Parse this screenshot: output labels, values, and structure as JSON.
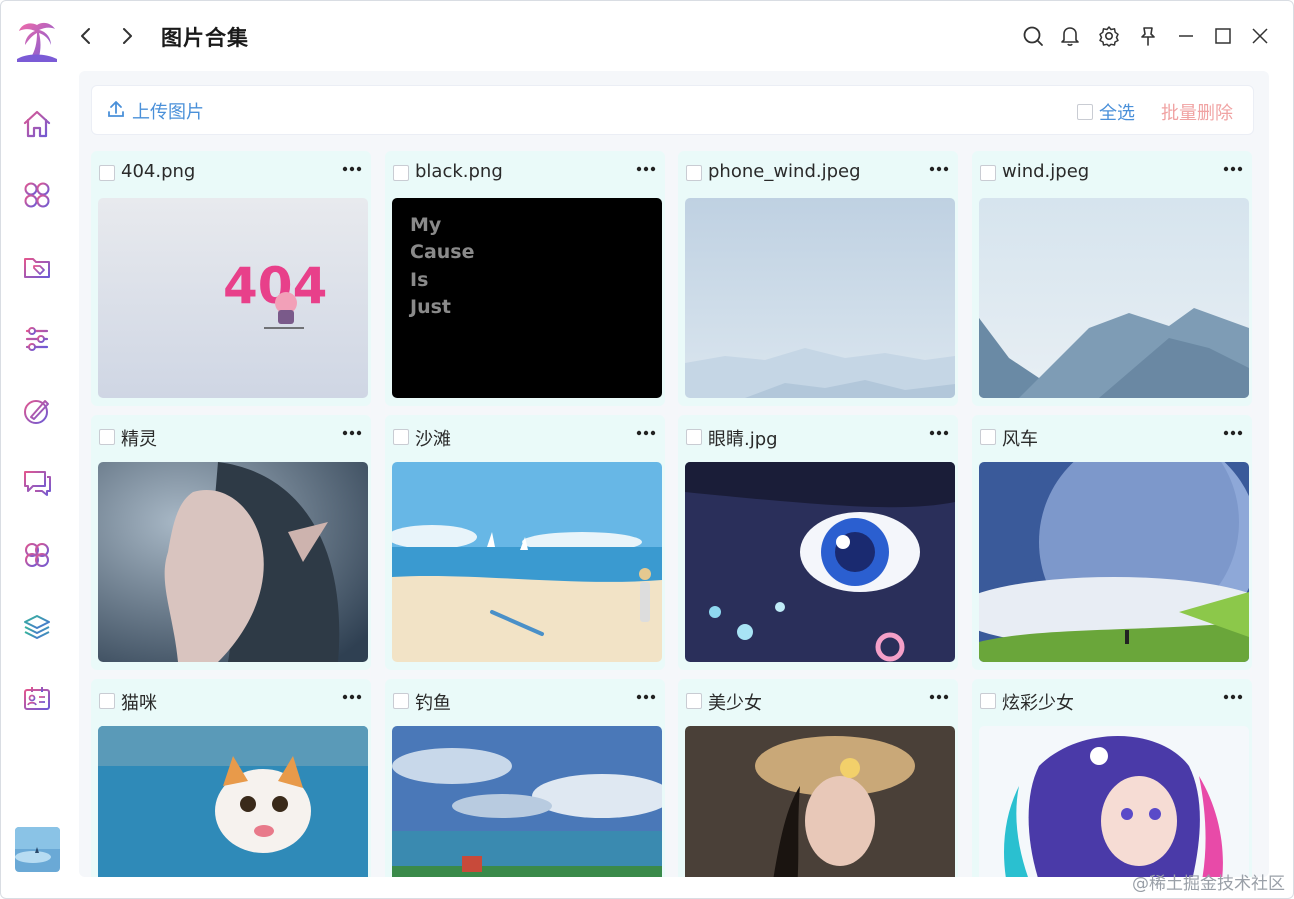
{
  "window": {
    "title": "图片合集"
  },
  "titlebar": {
    "icons": [
      "search-icon",
      "bell-icon",
      "gear-icon",
      "pin-icon",
      "minimize-icon",
      "maximize-icon",
      "close-icon"
    ]
  },
  "sidebar": {
    "items": [
      {
        "icon": "home-icon"
      },
      {
        "icon": "apps-icon"
      },
      {
        "icon": "folder-tag-icon"
      },
      {
        "icon": "list-settings-icon"
      },
      {
        "icon": "brush-icon"
      },
      {
        "icon": "chat-icon"
      },
      {
        "icon": "grid-circles-icon"
      },
      {
        "icon": "layers-icon"
      },
      {
        "icon": "id-card-icon"
      }
    ]
  },
  "toolbar": {
    "upload_label": "上传图片",
    "select_all_label": "全选",
    "batch_delete_label": "批量删除"
  },
  "images": [
    {
      "name": "404.png"
    },
    {
      "name": "black.png",
      "text_lines": [
        "My",
        "Cause",
        "Is",
        "Just"
      ]
    },
    {
      "name": "phone_wind.jpeg"
    },
    {
      "name": "wind.jpeg"
    },
    {
      "name": "精灵"
    },
    {
      "name": "沙滩"
    },
    {
      "name": "眼睛.jpg"
    },
    {
      "name": "风车"
    },
    {
      "name": "猫咪"
    },
    {
      "name": "钓鱼"
    },
    {
      "name": "美少女"
    },
    {
      "name": "炫彩少女"
    }
  ],
  "thumb_404": {
    "text": "404"
  },
  "watermark": "@稀土掘金技术社区",
  "colors": {
    "accent": "#4a90d9",
    "danger_light": "#f0a3a3",
    "card_bg": "#eafaf9",
    "icon_purple": "#8a5ab8"
  }
}
